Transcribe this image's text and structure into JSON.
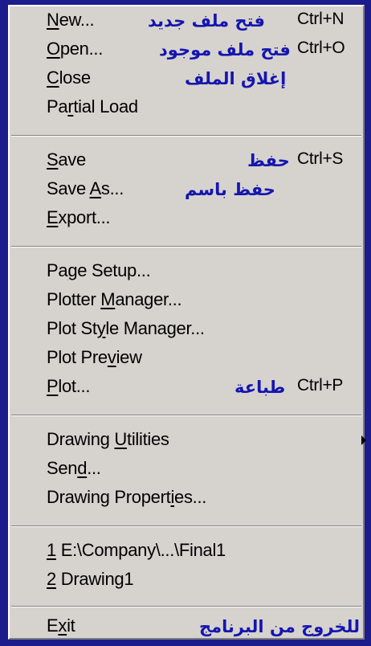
{
  "menu": {
    "new": {
      "pre": "",
      "ul": "N",
      "post": "ew...",
      "shortcut": "Ctrl+N",
      "arabic": "فتح ملف جديد"
    },
    "open": {
      "pre": "",
      "ul": "O",
      "post": "pen...",
      "shortcut": "Ctrl+O",
      "arabic": "فتح ملف موجود"
    },
    "close": {
      "pre": "",
      "ul": "C",
      "post": "lose",
      "arabic": "إغلاق الملف"
    },
    "partial_load": {
      "pre": "Pa",
      "ul": "r",
      "post": "tial Load"
    },
    "save": {
      "pre": "",
      "ul": "S",
      "post": "ave",
      "shortcut": "Ctrl+S",
      "arabic": "حفظ"
    },
    "save_as": {
      "pre": "Save ",
      "ul": "A",
      "post": "s...",
      "arabic": "حفظ باسم"
    },
    "export": {
      "pre": "",
      "ul": "E",
      "post": "xport..."
    },
    "page_setup": {
      "pre": "Pa",
      "ul": "g",
      "post": "e Setup..."
    },
    "plotter_manager": {
      "pre": "Plotter ",
      "ul": "M",
      "post": "anager..."
    },
    "plot_style_manager": {
      "pre": "Plot St",
      "ul": "y",
      "post": "le Manager..."
    },
    "plot_preview": {
      "pre": "Plot Pre",
      "ul": "v",
      "post": "iew"
    },
    "plot": {
      "pre": "",
      "ul": "P",
      "post": "lot...",
      "shortcut": "Ctrl+P",
      "arabic": "طباعة"
    },
    "drawing_utilities": {
      "pre": "Drawing ",
      "ul": "U",
      "post": "tilities"
    },
    "send": {
      "pre": "Sen",
      "ul": "d",
      "post": "..."
    },
    "drawing_properties": {
      "pre": "Drawing Propert",
      "ul": "i",
      "post": "es..."
    },
    "recent_1": {
      "pre": "",
      "ul": "1",
      "post": " E:\\Company\\...\\Final1"
    },
    "recent_2": {
      "pre": "",
      "ul": "2",
      "post": " Drawing1"
    },
    "exit": {
      "pre": "E",
      "ul": "x",
      "post": "it",
      "arabic": "للخروج من البرنامج"
    }
  }
}
